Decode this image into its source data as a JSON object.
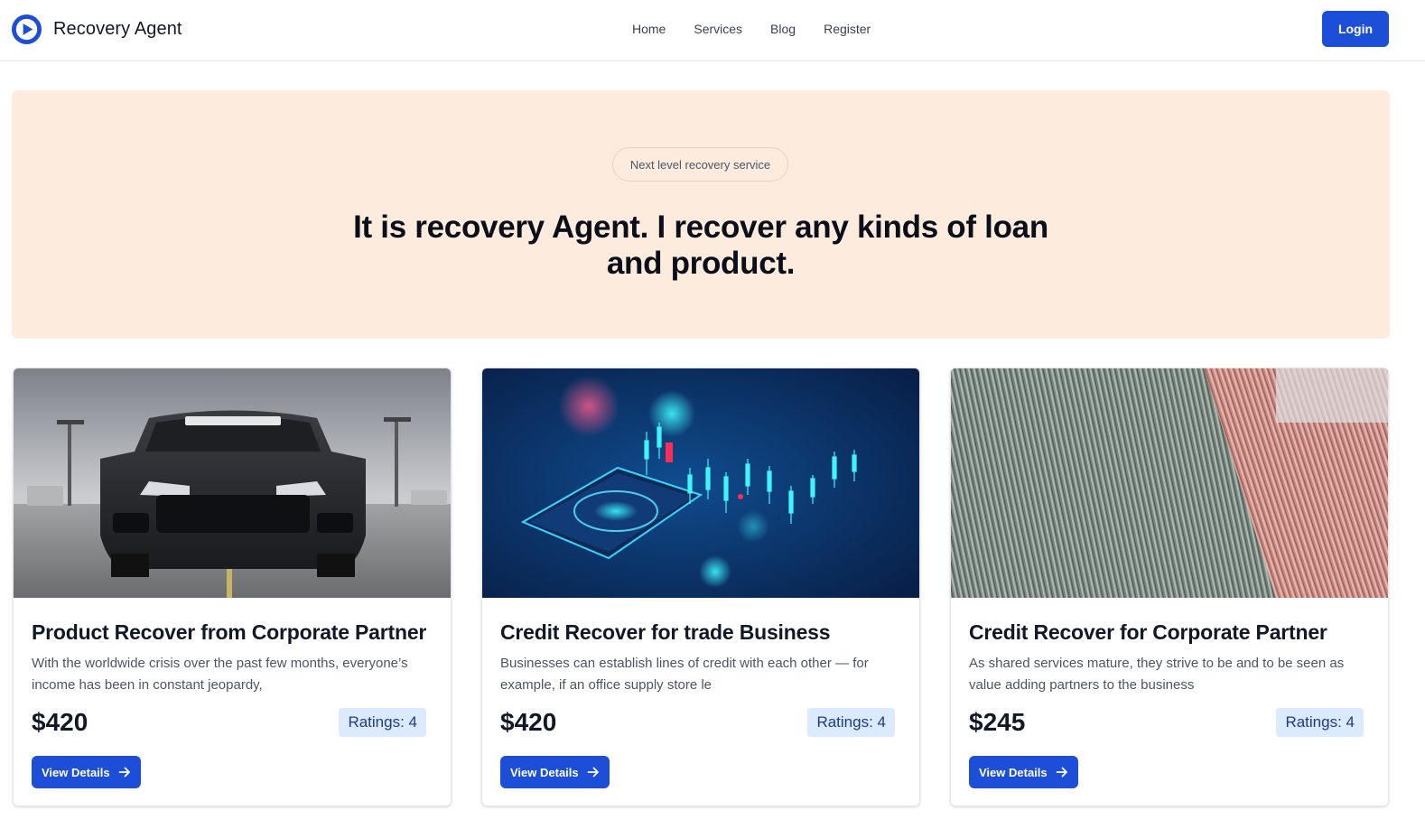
{
  "header": {
    "brand_name": "Recovery Agent",
    "nav": [
      "Home",
      "Services",
      "Blog",
      "Register"
    ],
    "login_label": "Login"
  },
  "hero": {
    "badge": "Next level recovery service",
    "title": "It is recovery Agent. I recover any kinds of loan and product."
  },
  "cards": [
    {
      "image_icon": "car-photo",
      "title": "Product Recover from Corporate Partner",
      "description": "With the worldwide crisis over the past few months, everyone’s income has been in constant jeopardy,",
      "price": "$420",
      "rating": "Ratings: 4",
      "button_label": "View Details"
    },
    {
      "image_icon": "phone-chart-photo",
      "title": "Credit Recover for trade Business",
      "description": "Businesses can establish lines of credit with each other — for example, if an office supply store le",
      "price": "$420",
      "rating": "Ratings: 4",
      "button_label": "View Details"
    },
    {
      "image_icon": "money-stack-photo",
      "title": "Credit Recover for Corporate Partner",
      "description": "As shared services mature, they strive to be and to be seen as value adding partners to the business",
      "price": "$245",
      "rating": "Ratings: 4",
      "button_label": "View Details"
    }
  ],
  "colors": {
    "primary": "#1d4ed8",
    "hero_background": "#fdecdd",
    "rating_background": "#dbeafe",
    "rating_text": "#1e3a8a"
  }
}
